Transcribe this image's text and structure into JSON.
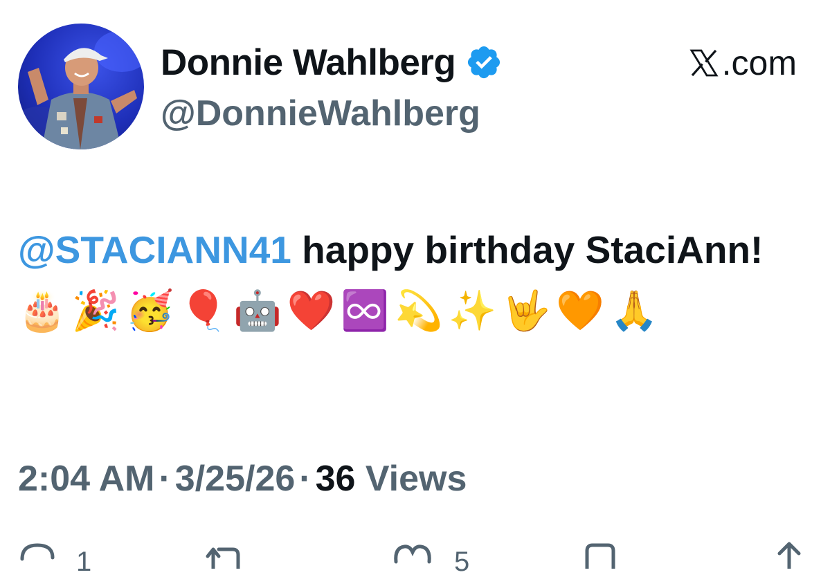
{
  "author": {
    "display_name": "Donnie Wahlberg",
    "handle": "@DonnieWahlberg",
    "verified": true,
    "verified_color": "#1d9bf0"
  },
  "source": {
    "label": ".com",
    "logo_icon": "x-logo-icon"
  },
  "tweet": {
    "mention": "@STACIANN41",
    "text": " happy birthday StaciAnn! ",
    "emojis": [
      "🎂",
      "🎉",
      "🥳",
      "🎈",
      "🤖",
      "❤️",
      "♾️",
      "💫",
      "✨",
      "🤟",
      "🧡",
      "🙏"
    ]
  },
  "meta": {
    "time": "2:04 AM",
    "separator": "·",
    "date": "3/25/26",
    "views_count": "36",
    "views_label": "Views"
  },
  "actions": {
    "reply_count": "1",
    "like_count": "5"
  },
  "colors": {
    "text": "#0f1419",
    "secondary": "#536471",
    "mention": "#3d97e0"
  }
}
